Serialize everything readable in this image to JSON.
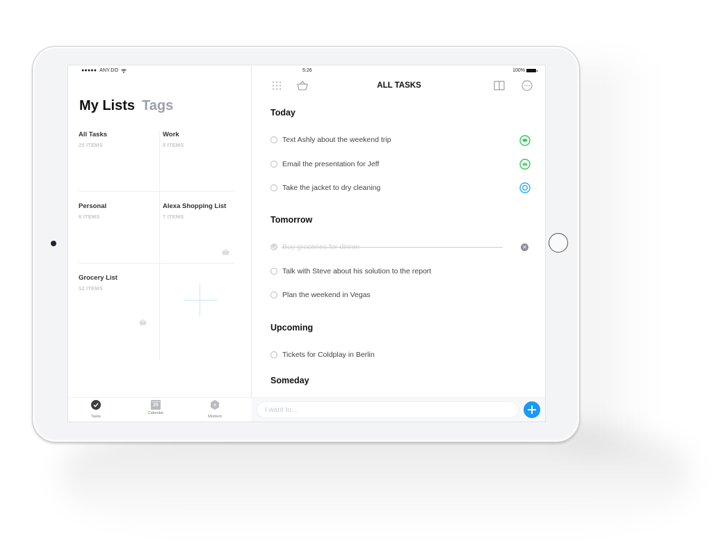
{
  "status_bar": {
    "carrier": "ANY.DO",
    "time": "5:26",
    "battery": "100%"
  },
  "lists_panel": {
    "title": "My Lists",
    "tags_tab": "Tags",
    "lists": [
      {
        "name": "All Tasks",
        "count": "25 ITEMS"
      },
      {
        "name": "Work",
        "count": "5 ITEMS"
      },
      {
        "name": "Personal",
        "count": "6 ITEMS"
      },
      {
        "name": "Alexa Shopping List",
        "count": "7 ITEMS",
        "icon": "basket-icon"
      },
      {
        "name": "Grocery List",
        "count": "12 ITEMS",
        "icon": "basket-icon"
      }
    ],
    "add_list_icon": "plus-icon"
  },
  "tab_bar": {
    "tabs": [
      {
        "label": "Tasks",
        "icon": "check-circle-icon",
        "active": true
      },
      {
        "label": "Calendar",
        "icon": "calendar-icon",
        "day": "26",
        "active": false
      },
      {
        "label": "Moment",
        "icon": "moment-hexagon-icon",
        "active": false
      }
    ]
  },
  "toolbar": {
    "title": "ALL TASKS",
    "left_icons": [
      "grid-dots-icon",
      "basket-icon"
    ],
    "right_icons": [
      "book-icon",
      "more-icon"
    ]
  },
  "sections": [
    {
      "title": "Today",
      "tasks": [
        {
          "text": "Text Ashly about the weekend trip",
          "done": false,
          "action": "message-icon",
          "action_color": "#34c759"
        },
        {
          "text": "Email the presentation for Jeff",
          "done": false,
          "action": "email-icon",
          "action_color": "#34c759"
        },
        {
          "text": "Take the jacket to dry cleaning",
          "done": false,
          "action": "location-icon",
          "action_color": "#2fa8f0"
        }
      ]
    },
    {
      "title": "Tomorrow",
      "tasks": [
        {
          "text": "Buy groceries for dinner",
          "done": true
        },
        {
          "text": "Talk with Steve about his solution to the report",
          "done": false
        },
        {
          "text": "Plan the weekend in Vegas",
          "done": false
        }
      ]
    },
    {
      "title": "Upcoming",
      "tasks": [
        {
          "text": "Tickets for Coldplay in Berlin",
          "done": false
        }
      ]
    },
    {
      "title": "Someday",
      "tasks": []
    }
  ],
  "input_bar": {
    "placeholder": "I want to...",
    "value": ""
  },
  "colors": {
    "accent": "#1a9af5",
    "green": "#34c759",
    "blue": "#2fa8f0"
  }
}
